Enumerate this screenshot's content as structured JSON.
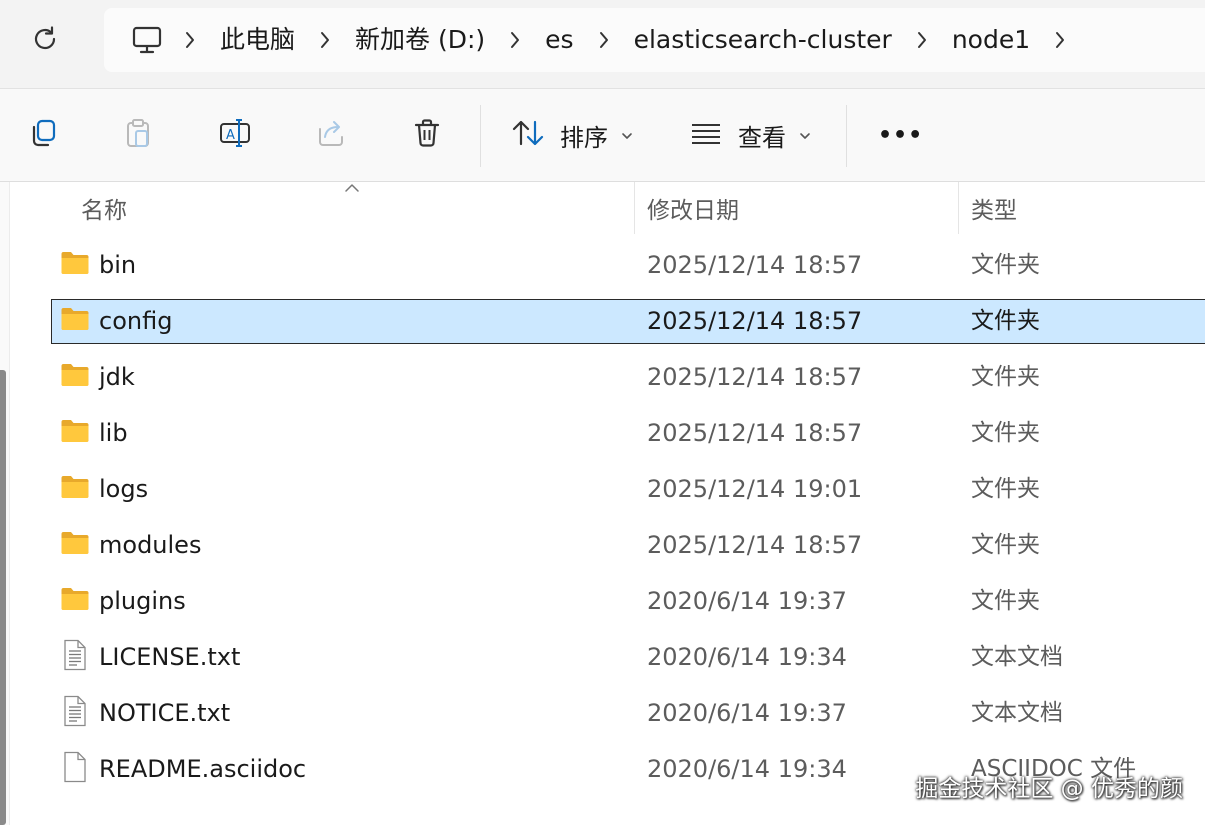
{
  "address_bar": {
    "refresh_icon": "refresh-icon",
    "pc_icon": "this-pc-icon",
    "breadcrumbs": [
      "此电脑",
      "新加卷 (D:)",
      "es",
      "elasticsearch-cluster",
      "node1"
    ]
  },
  "command_bar": {
    "buttons": [
      {
        "name": "copy",
        "icon": "copy-icon"
      },
      {
        "name": "paste",
        "icon": "paste-icon"
      },
      {
        "name": "rename",
        "icon": "rename-icon"
      },
      {
        "name": "share",
        "icon": "share-icon"
      },
      {
        "name": "delete",
        "icon": "trash-icon"
      }
    ],
    "sort_label": "排序",
    "view_label": "查看",
    "more_label": "•••"
  },
  "columns": {
    "name": "名称",
    "date": "修改日期",
    "type": "类型"
  },
  "files": [
    {
      "name": "bin",
      "date": "2025/12/14 18:57",
      "type": "文件夹",
      "kind": "folder",
      "selected": false
    },
    {
      "name": "config",
      "date": "2025/12/14 18:57",
      "type": "文件夹",
      "kind": "folder",
      "selected": true
    },
    {
      "name": "jdk",
      "date": "2025/12/14 18:57",
      "type": "文件夹",
      "kind": "folder",
      "selected": false
    },
    {
      "name": "lib",
      "date": "2025/12/14 18:57",
      "type": "文件夹",
      "kind": "folder",
      "selected": false
    },
    {
      "name": "logs",
      "date": "2025/12/14 19:01",
      "type": "文件夹",
      "kind": "folder",
      "selected": false
    },
    {
      "name": "modules",
      "date": "2025/12/14 18:57",
      "type": "文件夹",
      "kind": "folder",
      "selected": false
    },
    {
      "name": "plugins",
      "date": "2020/6/14 19:37",
      "type": "文件夹",
      "kind": "folder",
      "selected": false
    },
    {
      "name": "LICENSE.txt",
      "date": "2020/6/14 19:34",
      "type": "文本文档",
      "kind": "text",
      "selected": false
    },
    {
      "name": "NOTICE.txt",
      "date": "2020/6/14 19:37",
      "type": "文本文档",
      "kind": "text",
      "selected": false
    },
    {
      "name": "README.asciidoc",
      "date": "2020/6/14 19:34",
      "type": "ASCIIDOC 文件",
      "kind": "file",
      "selected": false
    }
  ],
  "watermark": "掘金技术社区 @ 优秀的颜",
  "colors": {
    "selection_bg": "#cce8ff",
    "folder_yellow": "#ffc83d",
    "accent_blue": "#0f6cbd"
  }
}
